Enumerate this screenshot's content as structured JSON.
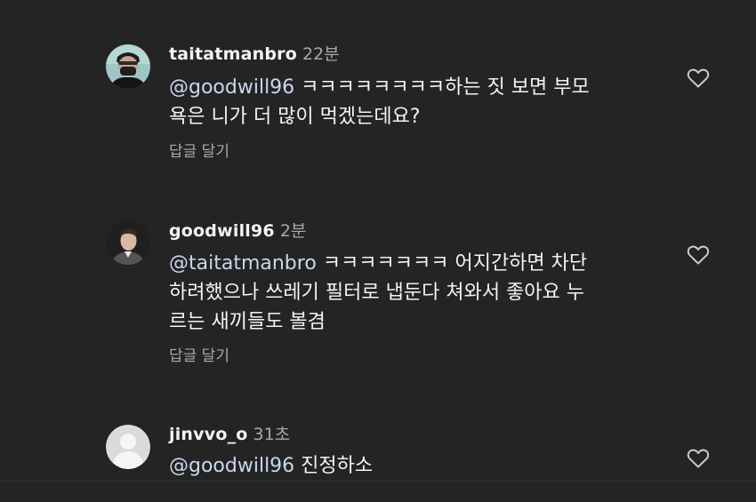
{
  "comments": [
    {
      "username": "taitatmanbro",
      "time": "22분",
      "mention": "@goodwill96",
      "line1_rest": " ㅋㅋㅋㅋㅋㅋㅋㅋ하는 짓 보면 부모",
      "line2": "욕은 니가 더 많이 먹겠는데요?",
      "reply_label": "답글 달기",
      "avatar_icon": "avatar-photo-masked-man"
    },
    {
      "username": "goodwill96",
      "time": "2분",
      "mention": "@taitatmanbro",
      "line1_rest": " ㅋㅋㅋㅋㅋㅋㅋ 어지간하면 차단",
      "line2": "하려했으나 쓰레기 필터로 냅둔다 쳐와서 좋아요 누",
      "line3": "르는 새끼들도 볼겸",
      "reply_label": "답글 달기",
      "avatar_icon": "avatar-photo-man"
    },
    {
      "username": "jinvvo_o",
      "time": "31초",
      "mention": "@goodwill96",
      "line1_rest": " 진정하소",
      "avatar_icon": "default-avatar-icon"
    }
  ],
  "colors": {
    "background": "#242424",
    "text": "#f3f3f3",
    "secondary_text": "#a8a8a8",
    "mention": "#c9d6ee"
  },
  "icons": {
    "like": "heart-outline-icon"
  }
}
